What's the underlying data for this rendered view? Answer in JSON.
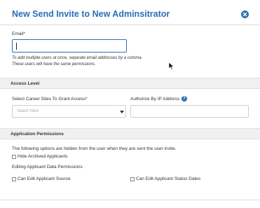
{
  "dialog": {
    "title": "New Send Invite to New Adminsitrator"
  },
  "email": {
    "label": "Email*",
    "value": "",
    "help_line1": "To add multiple users at once, separate email addresses by a comma.",
    "help_line2": "These users will have the same permissions."
  },
  "access_level": {
    "heading": "Access Level",
    "sites_label": "Select Career Sites To Grant Access*",
    "sites_placeholder": "Select Here",
    "ip_label": "Authorize By IP Address",
    "ip_value": ""
  },
  "permissions": {
    "heading": "Application Permissions",
    "note": "The following options are hidden from the user when they are sent the user invite.",
    "hide_archived_label": "Hide Archived Applicants",
    "editing_heading": "Editing Applicant Data Permissions",
    "edit_source_label": "Can Edit Applicant Source",
    "edit_status_dates_label": "Can Edit Applicant Status Dates"
  },
  "colors": {
    "accent": "#2d6fb3",
    "section_bg": "#f0f0f0"
  }
}
